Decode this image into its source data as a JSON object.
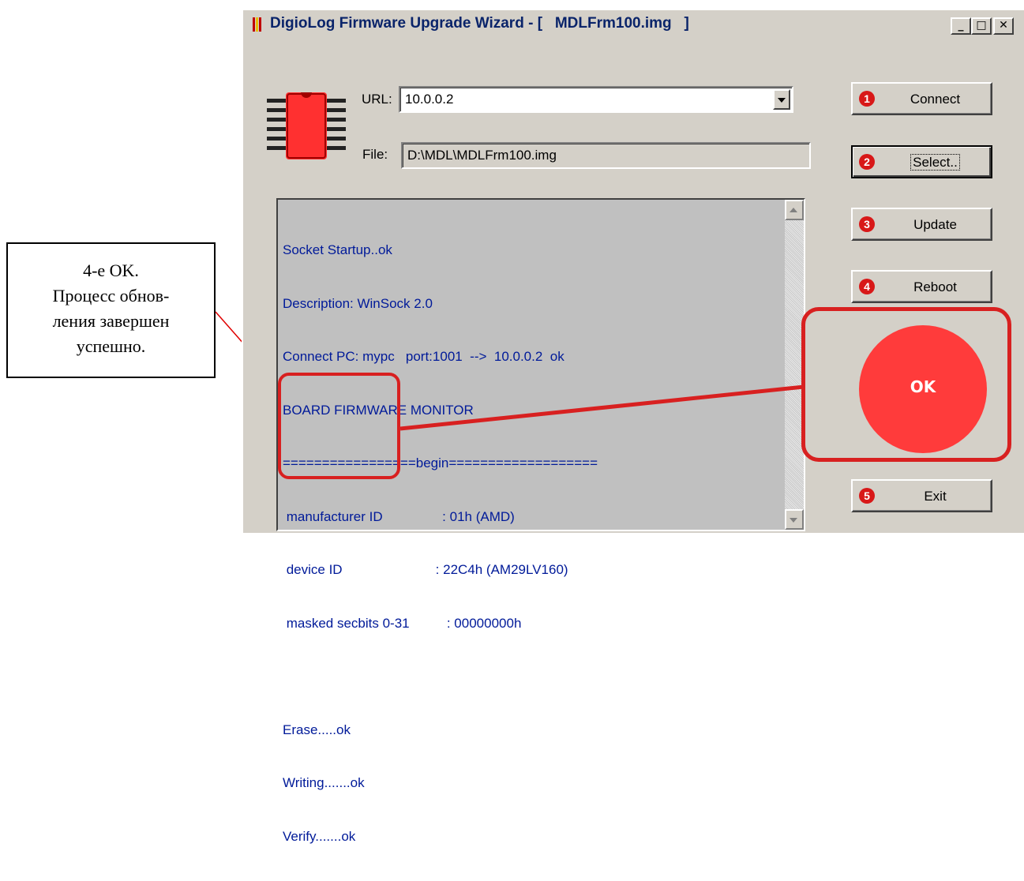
{
  "window": {
    "title": "DigioLog Firmware Upgrade Wizard - [   MDLFrm100.img   ]",
    "controls": {
      "minimize": "_",
      "maximize": "□",
      "close": "✕"
    }
  },
  "url": {
    "label": "URL:",
    "value": "10.0.0.2"
  },
  "file": {
    "label": "File:",
    "value": "D:\\MDL\\MDLFrm100.img"
  },
  "log": {
    "lines": [
      "Socket Startup..ok",
      "Description: WinSock 2.0",
      "Connect PC: mypc   port:1001  -->  10.0.0.2  ok",
      "BOARD FIRMWARE MONITOR",
      "=================begin===================",
      " manufacturer ID                : 01h (AMD)",
      " device ID                         : 22C4h (AM29LV160)",
      " masked secbits 0-31          : 00000000h",
      "",
      "Erase.....ok",
      "Writing.......ok",
      "Verify.......ok"
    ]
  },
  "buttons": [
    {
      "number": "1",
      "label": "Connect"
    },
    {
      "number": "2",
      "label": "Select.."
    },
    {
      "number": "3",
      "label": "Update"
    },
    {
      "number": "4",
      "label": "Reboot"
    },
    {
      "number": "5",
      "label": "Exit"
    }
  ],
  "status": {
    "ok_label": "OK"
  },
  "callout": {
    "lines": [
      "4-е OK.",
      "Процесс обнов-",
      "ления завершен",
      "успешно."
    ]
  },
  "colors": {
    "accent_red": "#d82020",
    "ok_circle": "#ff3b3b",
    "log_text": "#001a99",
    "title_text": "#0a246a"
  },
  "icons": [
    "chip-icon",
    "app-icon"
  ]
}
